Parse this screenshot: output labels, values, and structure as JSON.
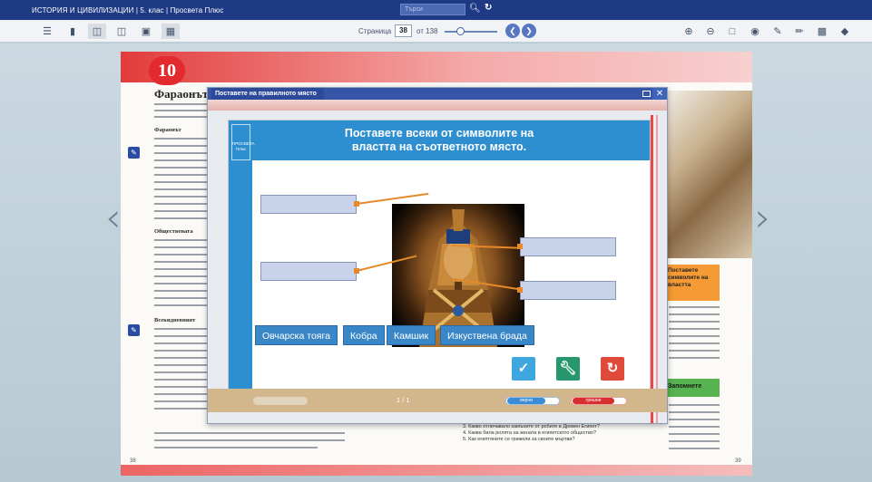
{
  "app": {
    "title": "ИСТОРИЯ И ЦИВИЛИЗАЦИИ | 5. клас | Просвета Плюс",
    "search_placeholder": "Търси"
  },
  "toolbar": {
    "page_label": "Страница",
    "current_page": "38",
    "page_of": "от 138",
    "zoom_level": 0.25,
    "icons": [
      "menu-icon",
      "single-page-icon",
      "two-page-icon",
      "double-spread-icon",
      "image-icon",
      "grid-icon",
      "zoom-in-icon",
      "zoom-out-icon",
      "fit-page-icon",
      "visibility-icon",
      "pen-icon",
      "highlighter-icon",
      "save-icon",
      "eraser-icon"
    ]
  },
  "book": {
    "chapter_number": "10",
    "heading": "Фараонът",
    "subheads": [
      "Фараонът",
      "Обществената",
      "Всекидневният"
    ],
    "left_page_number": "38",
    "right_page_number": "39",
    "orange_box_text": "Поставете символите на властта",
    "green_box_text": "Запомнете",
    "questions": [
      "3. Какво отличавало камъните от робите в Древен Египет?",
      "4. Каква била ролята на жената в египетското общество?",
      "5. Как египтяните се грижели за своите мъртви?"
    ]
  },
  "modal": {
    "title": "Поставете на правилното място",
    "instruction_line1": "Поставете всеки от символите на",
    "instruction_line2": "властта на съответното място.",
    "logo_text": "ПРОСВЕТА Плюс",
    "options": [
      "Овчарска тояга",
      "Кобра",
      "Камшик",
      "Изкуствена брада"
    ],
    "pager": "1 / 1",
    "correct_label": "верни",
    "correct_count": "0",
    "wrong_label": "грешни",
    "wrong_count": "0"
  },
  "colors": {
    "title_bar": "#1f3a85",
    "accent_blue": "#2e8fd0",
    "chip_blue": "#3a87c7",
    "check_button": "#3fa7df",
    "wrench_button": "#27976e",
    "reset_button": "#e04a3a",
    "chapter_red": "#e32b2f",
    "connector_orange": "#e58a2c"
  }
}
